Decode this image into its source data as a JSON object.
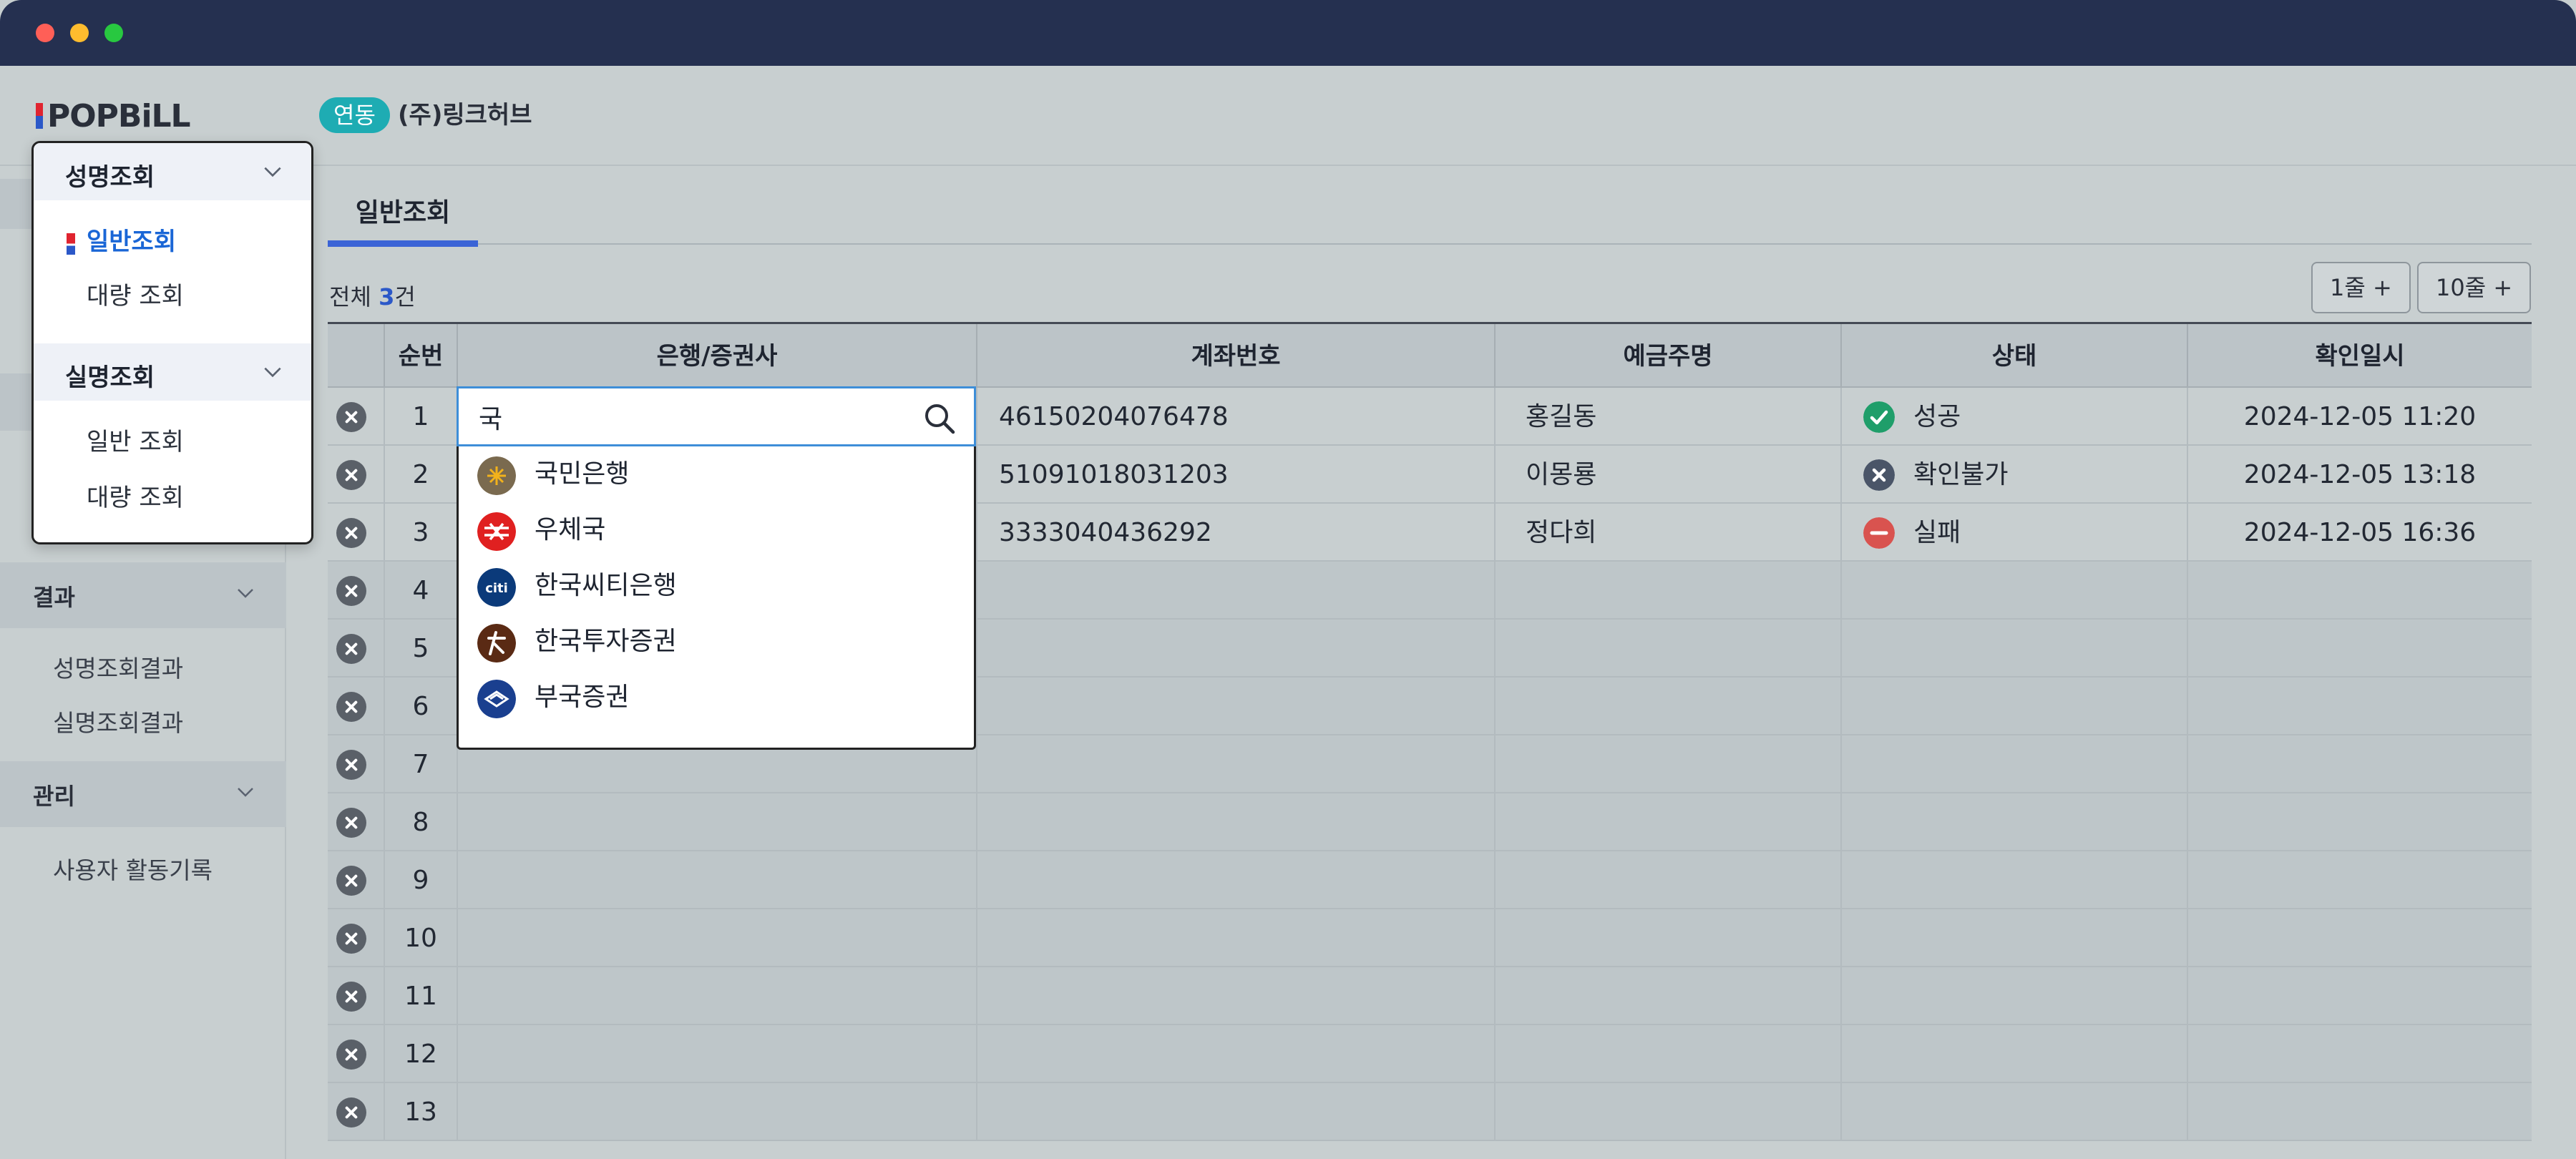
{
  "header": {
    "logo_text": "POPBiLL",
    "badge": "연동",
    "company": "(주)링크허브"
  },
  "popup": {
    "sections": [
      {
        "title": "성명조회",
        "items": [
          "일반조회",
          "대량 조회"
        ],
        "active_item": "일반조회"
      },
      {
        "title": "실명조회",
        "items": [
          "일반 조회",
          "대량 조회"
        ]
      }
    ]
  },
  "sidebar": {
    "sections": [
      {
        "title": "결과",
        "items": [
          "성명조회결과",
          "실명조회결과"
        ]
      },
      {
        "title": "관리",
        "items": [
          "사용자 활동기록"
        ]
      }
    ]
  },
  "tabs": [
    {
      "label": "일반조회",
      "active": true
    }
  ],
  "summary": {
    "prefix": "전체 ",
    "count": "3",
    "suffix": "건"
  },
  "buttons": {
    "add_one": "1줄 +",
    "add_ten": "10줄 +"
  },
  "table": {
    "columns": [
      "순번",
      "은행/증권사",
      "계좌번호",
      "예금주명",
      "상태",
      "확인일시"
    ],
    "rows": [
      {
        "no": "1",
        "bank": "",
        "account": "46150204076478",
        "holder": "홍길동",
        "status": "성공",
        "status_type": "success",
        "datetime": "2024-12-05 11:20"
      },
      {
        "no": "2",
        "bank": "",
        "account": "51091018031203",
        "holder": "이몽룡",
        "status": "확인불가",
        "status_type": "unknown",
        "datetime": "2024-12-05 13:18"
      },
      {
        "no": "3",
        "bank": "",
        "account": "3333040436292",
        "holder": "정다희",
        "status": "실패",
        "status_type": "fail",
        "datetime": "2024-12-05 16:36"
      }
    ],
    "empty_row_numbers": [
      "4",
      "5",
      "6",
      "7",
      "8",
      "9",
      "10",
      "11",
      "12",
      "13"
    ]
  },
  "search": {
    "value": "국",
    "results": [
      {
        "label": "국민은행",
        "icon": "kb-bank-logo",
        "color": "#7a6a4f"
      },
      {
        "label": "우체국",
        "icon": "korea-post-logo",
        "color": "#e02020"
      },
      {
        "label": "한국씨티은행",
        "icon": "citibank-logo",
        "color": "#0b3a7a"
      },
      {
        "label": "한국투자증권",
        "icon": "korea-investment-logo",
        "color": "#5a2a14"
      },
      {
        "label": "부국증권",
        "icon": "bookook-securities-logo",
        "color": "#1a3f8f"
      }
    ]
  },
  "colors": {
    "success": "#1f9e6a",
    "unknown": "#4a5568",
    "fail": "#d9534f",
    "accent": "#3b64d6",
    "teal": "#1eacb3"
  }
}
